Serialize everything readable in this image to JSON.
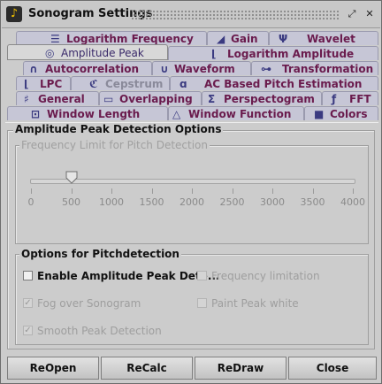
{
  "window": {
    "title": "Sonogram Settings",
    "title_icon": "sonogram-app-icon"
  },
  "titlebar_buttons": [
    {
      "name": "restore-icon",
      "glyph": "⤢"
    },
    {
      "name": "close-icon",
      "glyph": "✕"
    }
  ],
  "tabs": {
    "selected": "Amplitude Peak",
    "items": [
      {
        "label": "Logarithm Frequency",
        "icon": "waves-icon",
        "glyph": "☰"
      },
      {
        "label": "Gain",
        "icon": "gain-icon",
        "glyph": "◢"
      },
      {
        "label": "Wavelet",
        "icon": "wavelet-icon",
        "glyph": "Ψ"
      },
      {
        "label": "Amplitude Peak",
        "icon": "amplitude-peak-icon",
        "glyph": "◎"
      },
      {
        "label": "Logarithm Amplitude",
        "icon": "log-amplitude-icon",
        "glyph": "⌊"
      },
      {
        "label": "Autocorrelation",
        "icon": "autocorrelation-icon",
        "glyph": "∩"
      },
      {
        "label": "Waveform",
        "icon": "waveform-icon",
        "glyph": "∪"
      },
      {
        "label": "Transformation",
        "icon": "transformation-icon",
        "glyph": "⊶"
      },
      {
        "label": "LPC",
        "icon": "lpc-icon",
        "glyph": "⌊"
      },
      {
        "label": "Cepstrum",
        "icon": "cepstrum-icon",
        "glyph": "ℭ"
      },
      {
        "label": "AC Based Pitch Estimation",
        "icon": "ac-pitch-icon",
        "glyph": "ɑ"
      },
      {
        "label": "General",
        "icon": "general-icon",
        "glyph": "♯"
      },
      {
        "label": "Overlapping",
        "icon": "overlapping-icon",
        "glyph": "▭"
      },
      {
        "label": "Perspectogram",
        "icon": "perspectogram-icon",
        "glyph": "Ʃ"
      },
      {
        "label": "FFT",
        "icon": "fft-icon",
        "glyph": "ƒ"
      },
      {
        "label": "Window Length",
        "icon": "window-length-icon",
        "glyph": "⊡"
      },
      {
        "label": "Window Function",
        "icon": "window-function-icon",
        "glyph": "△"
      },
      {
        "label": "Colors",
        "icon": "colors-icon",
        "glyph": "■"
      }
    ]
  },
  "panel": {
    "group_title": "Amplitude Peak Detection Options",
    "frequency_limit": {
      "title": "Frequency Limit for Pitch Detection",
      "slider_value": 500,
      "slider_min": 0,
      "slider_max": 4000,
      "tick_labels": [
        "0",
        "500",
        "1000",
        "1500",
        "2000",
        "2500",
        "3000",
        "3500",
        "4000"
      ]
    },
    "pitch_options": {
      "title": "Options for Pitchdetection",
      "checkboxes": [
        {
          "label": "Enable Amplitude Peak Dete...",
          "checked": false,
          "enabled": true
        },
        {
          "label": "Frequency limitation",
          "checked": false,
          "enabled": false
        },
        {
          "label": "Fog over Sonogram",
          "checked": true,
          "enabled": false
        },
        {
          "label": "Paint Peak white",
          "checked": false,
          "enabled": false
        },
        {
          "label": "Smooth Peak Detection",
          "checked": true,
          "enabled": false
        }
      ]
    }
  },
  "buttons": {
    "reopen": "ReOpen",
    "recalc": "ReCalc",
    "redraw": "ReDraw",
    "close": "Close"
  },
  "colors": {
    "tab_text": "#6a1b4d",
    "tab_background": "#c6c6d6",
    "panel_background": "#cccccc",
    "disabled_text": "#9e9e9e"
  }
}
